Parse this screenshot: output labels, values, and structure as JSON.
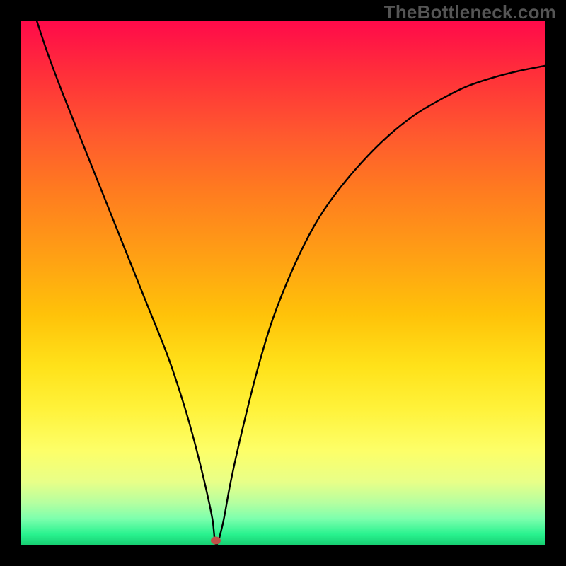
{
  "watermark": "TheBottleneck.com",
  "chart_data": {
    "type": "line",
    "title": "",
    "xlabel": "",
    "ylabel": "",
    "xlim": [
      0,
      100
    ],
    "ylim": [
      0,
      100
    ],
    "series": [
      {
        "name": "curve",
        "x": [
          3,
          5,
          8,
          12,
          16,
          20,
          24,
          28,
          31,
          33,
          35,
          36.5,
          37.2,
          38.5,
          40,
          42,
          45,
          48,
          52,
          56,
          60,
          65,
          70,
          75,
          80,
          85,
          90,
          95,
          100
        ],
        "values": [
          100,
          94,
          86,
          76,
          66,
          56,
          46,
          36,
          27,
          20,
          12,
          5,
          0,
          4,
          12,
          21,
          33,
          43,
          53,
          61,
          67,
          73,
          78,
          82,
          85,
          87.5,
          89.2,
          90.5,
          91.5
        ]
      }
    ],
    "marker": {
      "x": 37.2,
      "y": 0.8,
      "color": "#c05048"
    },
    "gradient_stops": [
      {
        "pos": 0,
        "color": "#ff0a4a"
      },
      {
        "pos": 10,
        "color": "#ff2f3a"
      },
      {
        "pos": 22,
        "color": "#ff5a2e"
      },
      {
        "pos": 32,
        "color": "#ff7a20"
      },
      {
        "pos": 45,
        "color": "#ffa014"
      },
      {
        "pos": 56,
        "color": "#ffc209"
      },
      {
        "pos": 66,
        "color": "#ffe21a"
      },
      {
        "pos": 74,
        "color": "#fff23a"
      },
      {
        "pos": 82,
        "color": "#fdff68"
      },
      {
        "pos": 88,
        "color": "#e8ff88"
      },
      {
        "pos": 92,
        "color": "#b5ffa0"
      },
      {
        "pos": 95,
        "color": "#7dffad"
      },
      {
        "pos": 98,
        "color": "#29f28f"
      },
      {
        "pos": 100,
        "color": "#17cf72"
      }
    ]
  }
}
